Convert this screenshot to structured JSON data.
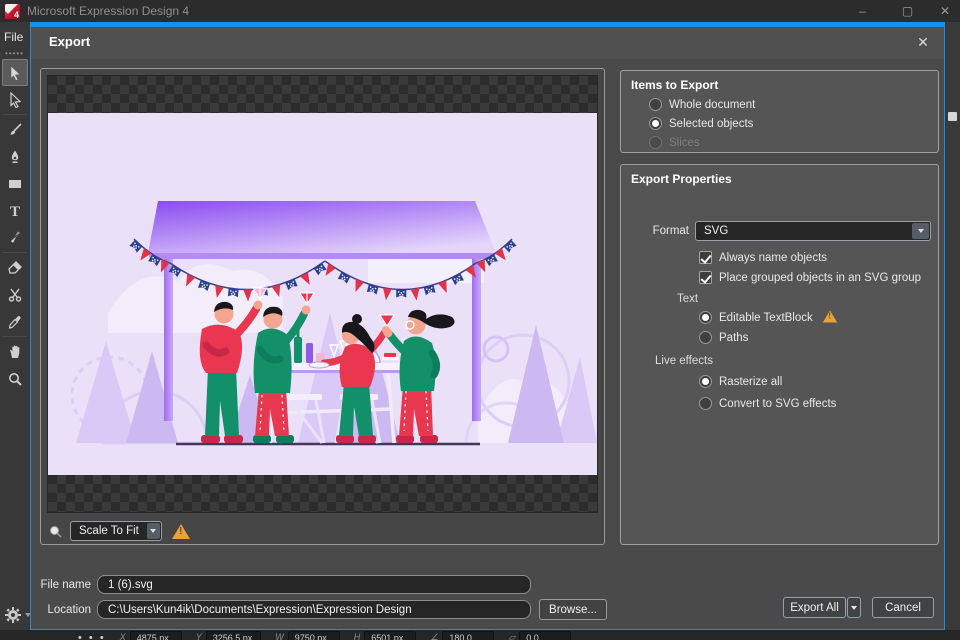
{
  "window": {
    "title": "Microsoft Expression Design 4",
    "icon_label": "4",
    "controls": {
      "minimize": "–",
      "maximize": "▢",
      "close": "✕"
    }
  },
  "menu": {
    "file": "File"
  },
  "toolbar": {
    "tools": [
      "selection",
      "direct-selection",
      "paintbrush",
      "pen",
      "rectangle",
      "text",
      "ink",
      "eraser",
      "scissors",
      "eyedropper",
      "pan",
      "zoom"
    ],
    "selected_tool": "selection"
  },
  "dialog": {
    "title": "Export",
    "close_glyph": "✕",
    "items_to_export": {
      "title": "Items to Export",
      "options": [
        {
          "label": "Whole document",
          "selected": false,
          "enabled": true
        },
        {
          "label": "Selected objects",
          "selected": true,
          "enabled": true
        },
        {
          "label": "Slices",
          "selected": false,
          "enabled": false
        }
      ]
    },
    "export_properties": {
      "title": "Export Properties",
      "format_label": "Format",
      "format_value": "SVG",
      "checkboxes": [
        {
          "label": "Always name objects",
          "checked": true
        },
        {
          "label": "Place grouped objects in an SVG group",
          "checked": true
        }
      ],
      "text_group": {
        "label": "Text",
        "options": [
          {
            "label": "Editable TextBlock",
            "selected": true,
            "warning": true
          },
          {
            "label": "Paths",
            "selected": false,
            "warning": false
          }
        ]
      },
      "live_effects_group": {
        "label": "Live effects",
        "options": [
          {
            "label": "Rasterize all",
            "selected": true
          },
          {
            "label": "Convert to SVG effects",
            "selected": false
          }
        ]
      }
    },
    "preview": {
      "scale_mode": "Scale To Fit",
      "has_warning": true
    },
    "file_name_label": "File name",
    "file_name_value": "1 (6).svg",
    "location_label": "Location",
    "location_value": "C:\\Users\\Kun4ik\\Documents\\Expression\\Expression Design",
    "browse_label": "Browse...",
    "export_all_label": "Export All",
    "cancel_label": "Cancel"
  },
  "status_bar": {
    "dots": "• • •",
    "fields": [
      {
        "label": "X",
        "value": "4875 px"
      },
      {
        "label": "Y",
        "value": "3256.5 px"
      },
      {
        "label": "W",
        "value": "9750 px"
      },
      {
        "label": "H",
        "value": "6501 px"
      },
      {
        "label": "∠",
        "value": "180.0"
      },
      {
        "label": "▱",
        "value": "0.0"
      }
    ]
  },
  "colors": {
    "accent": "#1691e8",
    "warning": "#e6a23c",
    "art_red": "#e8374f",
    "art_green": "#149068",
    "art_purple": "#9a5ff0"
  }
}
